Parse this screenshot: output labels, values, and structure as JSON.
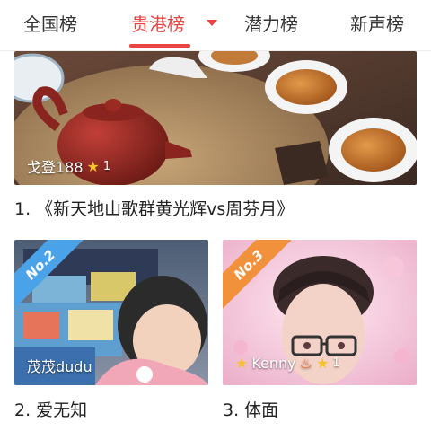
{
  "tabs": [
    {
      "label": "全国榜"
    },
    {
      "label": "贵港榜"
    },
    {
      "label": "潜力榜"
    },
    {
      "label": "新声榜"
    }
  ],
  "cards": [
    {
      "rank_title": "1. 《新天地山歌群黄光辉vs周芬月》",
      "user": "戈登188",
      "star_count": "1"
    },
    {
      "rank_title": "2. 爱无知",
      "user": "茂茂dudu",
      "badge": "No.2",
      "badge_color": "#4aa3e8"
    },
    {
      "rank_title": "3. 体面",
      "user": "Kenny",
      "star_count": "1",
      "badge": "No.3",
      "badge_color": "#f2913c"
    }
  ],
  "colors": {
    "accent": "#e94545"
  }
}
